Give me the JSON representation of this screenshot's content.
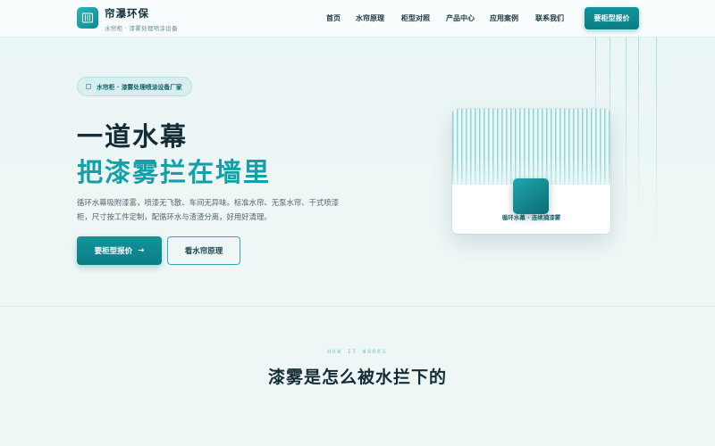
{
  "brand": {
    "name": "帘瀑环保",
    "tagline": "水帘柜 · 漆雾处理喷涂设备"
  },
  "nav": {
    "items": [
      {
        "label": "首页"
      },
      {
        "label": "水帘原理"
      },
      {
        "label": "柜型对照"
      },
      {
        "label": "产品中心"
      },
      {
        "label": "应用案例"
      },
      {
        "label": "联系我们"
      }
    ],
    "cta_label": "要柜型报价"
  },
  "hero": {
    "pill_text": "水帘柜 · 漆雾处理喷涂设备厂家",
    "headline_line1": "一道水幕",
    "headline_line2": "把漆雾拦在墙里",
    "description": "循环水幕吸附漆雾，喷漆无飞散、车间无异味。标准水帘、无泵水帘、干式喷漆柜，尺寸按工件定制，配循环水与渣渣分离，好用好清理。",
    "primary_button": "要柜型报价",
    "primary_arrow": "→",
    "secondary_button": "看水帘原理",
    "illustration_caption": "循环水幕 · 连续捕漆雾"
  },
  "how_it_works": {
    "eyebrow": "HOW IT WORKS",
    "title": "漆雾是怎么被水拦下的"
  },
  "colors": {
    "accent": "#0a7d86",
    "accent_light": "#13a0a8",
    "background": "#eef6f6",
    "heading": "#132c35"
  }
}
